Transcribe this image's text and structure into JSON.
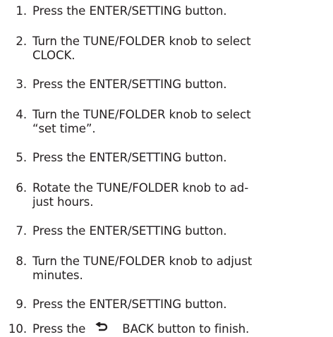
{
  "steps": [
    {
      "number": "1.",
      "lines": [
        "Press the ENTER/SETTING button."
      ]
    },
    {
      "number": "2.",
      "lines": [
        "Turn the TUNE/FOLDER knob to select",
        "CLOCK."
      ]
    },
    {
      "number": "3.",
      "lines": [
        "Press the ENTER/SETTING button."
      ]
    },
    {
      "number": "4.",
      "lines": [
        "Turn the TUNE/FOLDER knob to select",
        "“set time”."
      ]
    },
    {
      "number": "5.",
      "lines": [
        "Press the ENTER/SETTING button."
      ]
    },
    {
      "number": "6.",
      "lines": [
        "Rotate the TUNE/FOLDER knob to ad-",
        "just hours."
      ]
    },
    {
      "number": "7.",
      "lines": [
        "Press the ENTER/SETTING button."
      ]
    },
    {
      "number": "8.",
      "lines": [
        "Turn the TUNE/FOLDER knob to adjust",
        "minutes."
      ]
    },
    {
      "number": "9.",
      "lines": [
        "Press the ENTER/SETTING button."
      ]
    },
    {
      "number": "10.",
      "lines": [
        "Press the",
        "BACK button to finish."
      ]
    }
  ],
  "icons": {
    "step10": "back-arrow-icon"
  }
}
